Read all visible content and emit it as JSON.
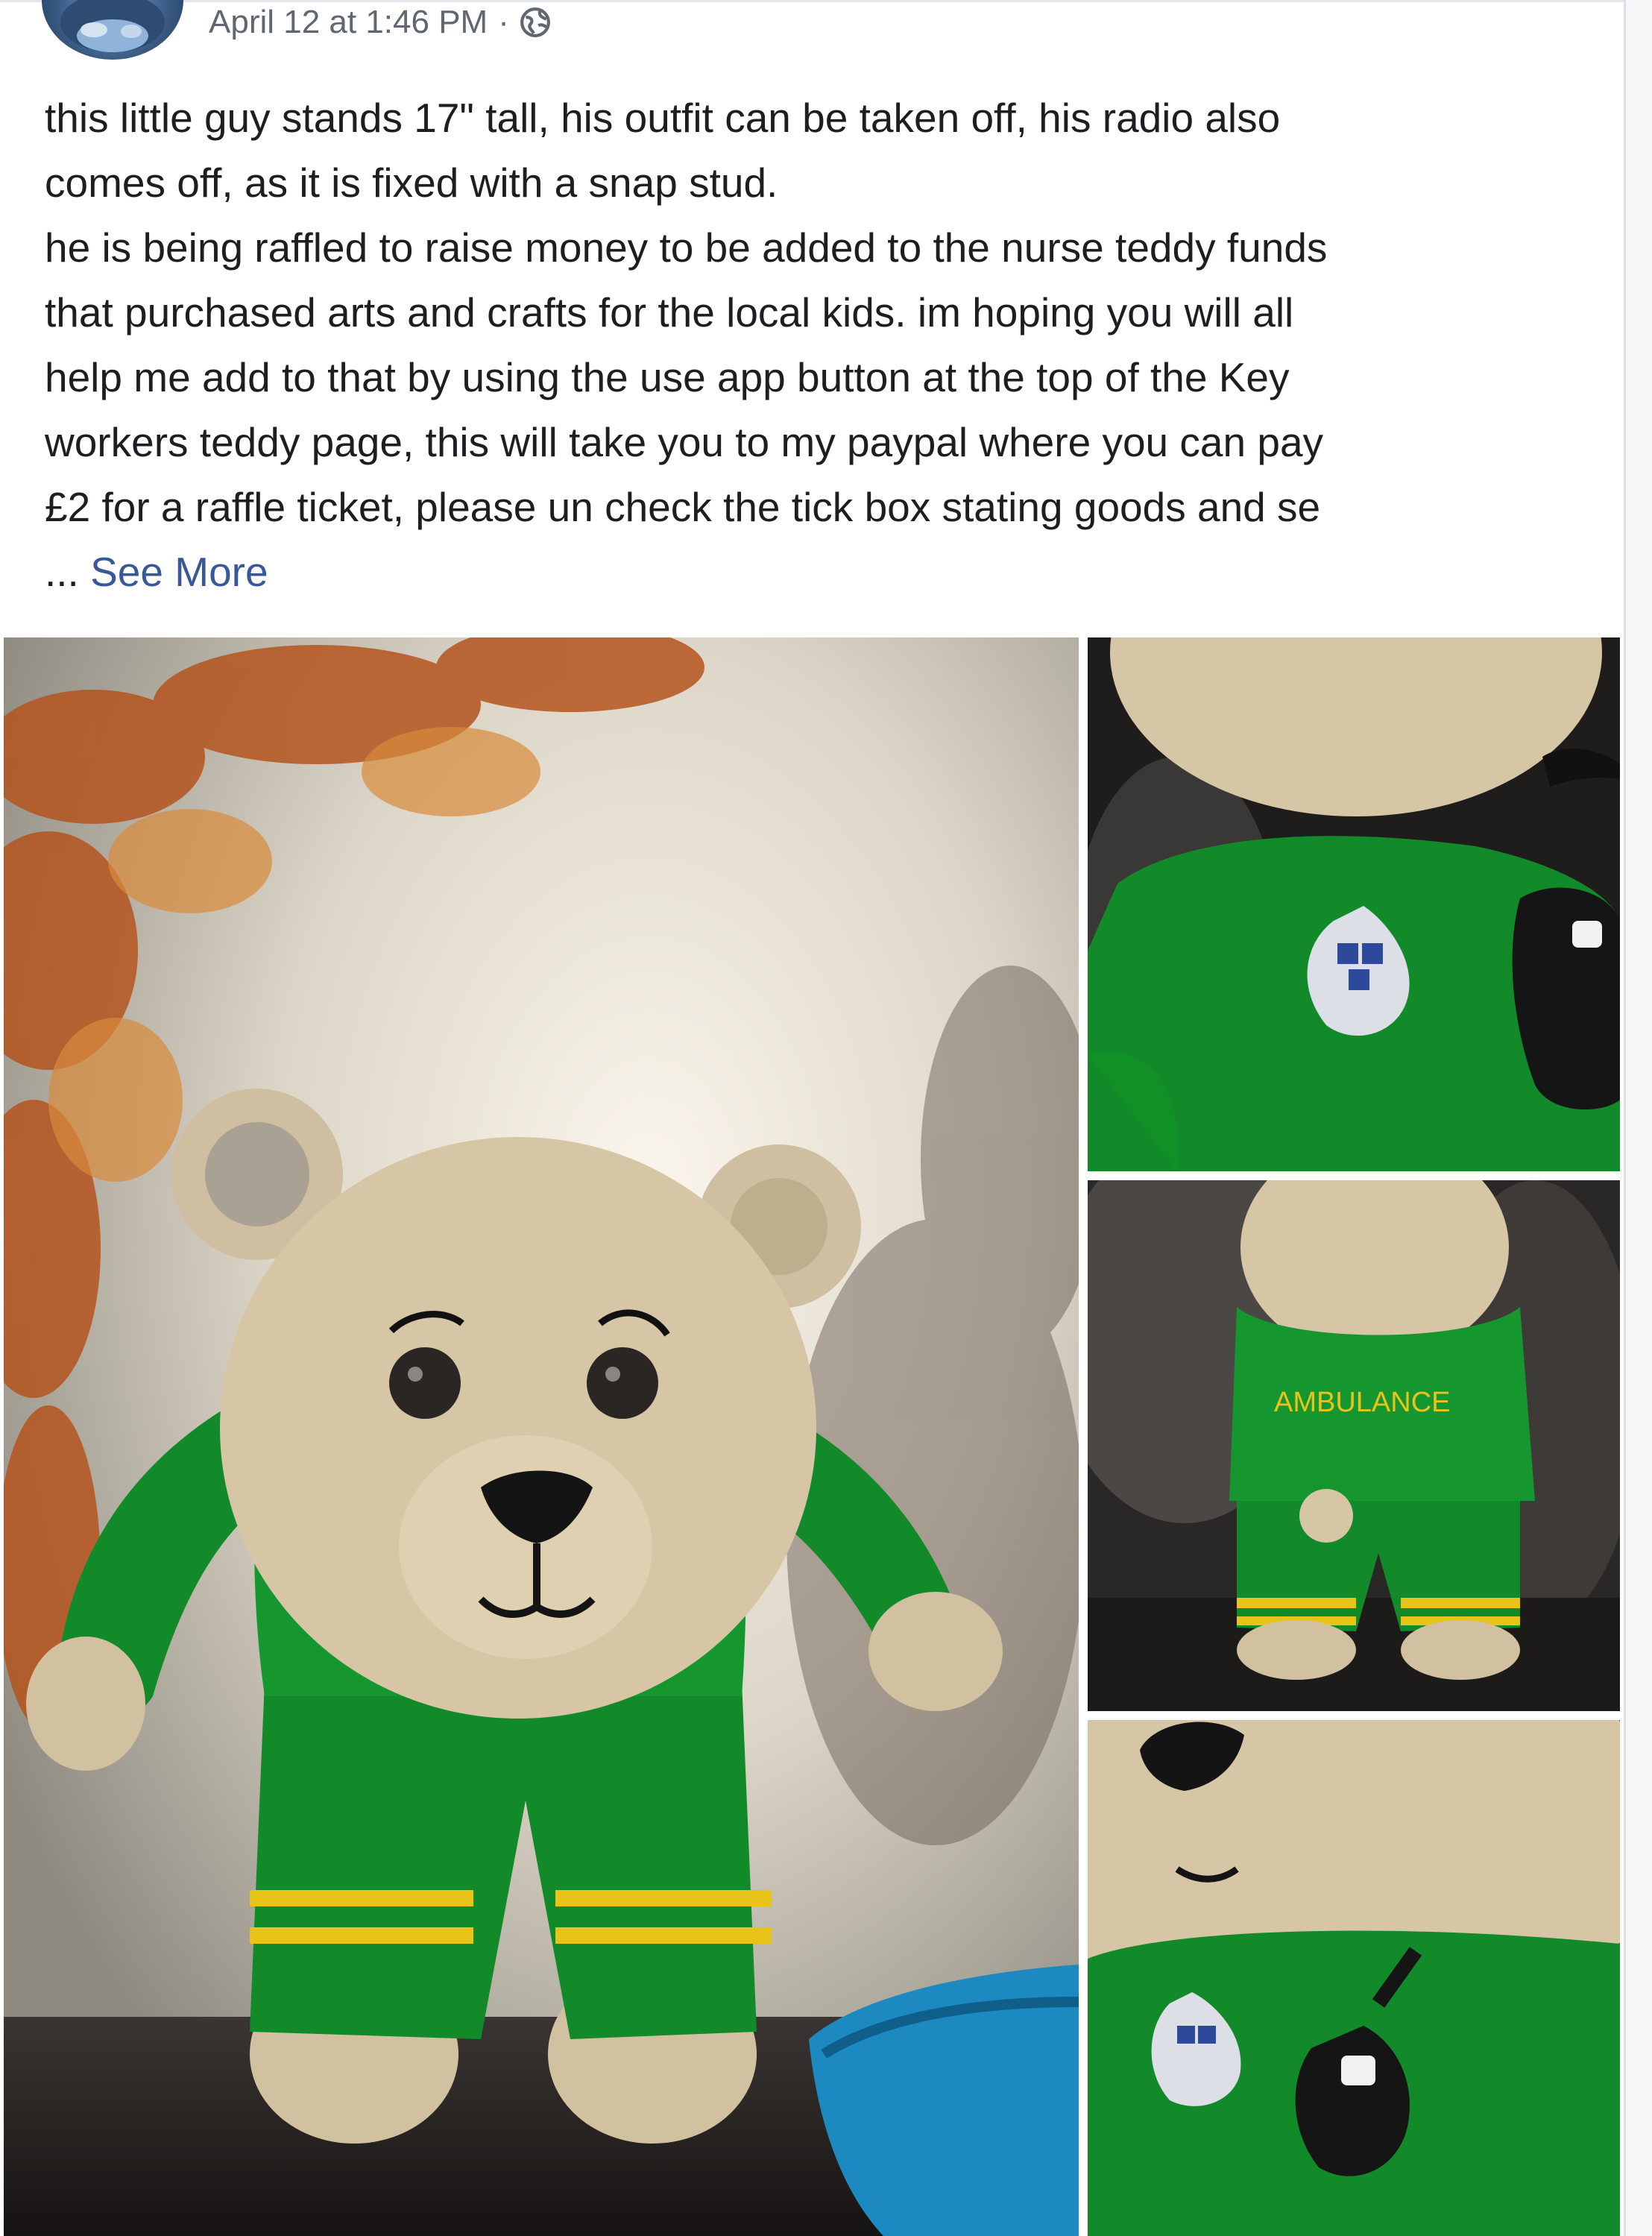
{
  "post": {
    "timestamp": "April 12 at 1:46 PM",
    "separator": "·",
    "privacy_icon": "globe-icon",
    "body_lines": [
      "this little guy stands 17\" tall, his outfit can be taken off, his radio also",
      "comes off, as it is fixed with a snap stud.",
      "he is being raffled to raise money to be added to the nurse teddy funds",
      "that purchased arts and crafts for the local kids. im hoping you will all",
      "help me add to that by using the use app button at the top of the Key",
      "workers teddy page, this will take you to my paypal where you can pay",
      "£2 for a raffle ticket, please un check the tick box stating goods and se"
    ],
    "ellipsis": "...",
    "see_more": "See More"
  },
  "photos": {
    "main_alt": "Crocheted teddy bear in green paramedic outfit with radio",
    "side_top_alt": "Close-up of teddy outfit with badge and radio",
    "side_mid_alt": "Back of teddy outfit",
    "side_mid_text": "AMBULANCE",
    "side_bottom_alt": "Close-up of teddy face and outfit"
  },
  "colors": {
    "link": "#385898",
    "meta_text": "#606770",
    "body_text": "#1c1e21",
    "outfit_green": "#138a2a",
    "stripe_yellow": "#e8c31a",
    "yarn_beige": "#d2c1a1"
  }
}
